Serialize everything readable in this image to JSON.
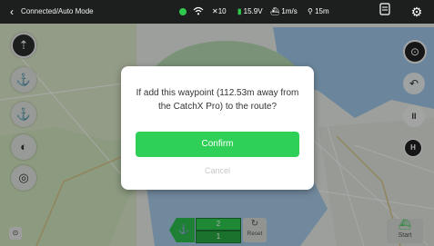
{
  "topbar": {
    "back_icon": "‹",
    "mode": "Connected/Auto Mode",
    "status_dot_color": "#2fc94d",
    "wifi_icon": "wifi-icon",
    "satellites": "✕10",
    "battery_icon": "▮",
    "battery": "15.9V",
    "speed": "⛴ 1m/s",
    "distance": "⚲ 15m",
    "waypoints_icon": "waypoints-icon",
    "settings_icon": "gear-icon"
  },
  "left_tools": {
    "compass_icon": "⇡",
    "anchor_alt_icon": "⚓",
    "anchor_icon": "⚓",
    "light_icon": "◐",
    "sonar_icon": "◎"
  },
  "right_tools": {
    "location_icon": "⊙",
    "return_icon": "↶",
    "pause_icon": "II",
    "home_label": "H"
  },
  "bottom": {
    "mini_icon": "⊙",
    "waypoint_icon": "⚓",
    "waypoint_count_top": "2",
    "waypoint_count_bottom": "1",
    "reset_icon": "↻",
    "reset_label": "Reset",
    "start_icon": "⛴",
    "start_label": "Start"
  },
  "dialog": {
    "message": "If add this waypoint (112.53m away from the CatchX Pro) to the route?",
    "confirm_label": "Confirm",
    "cancel_label": "Cancel",
    "accent_color": "#2fd057"
  }
}
